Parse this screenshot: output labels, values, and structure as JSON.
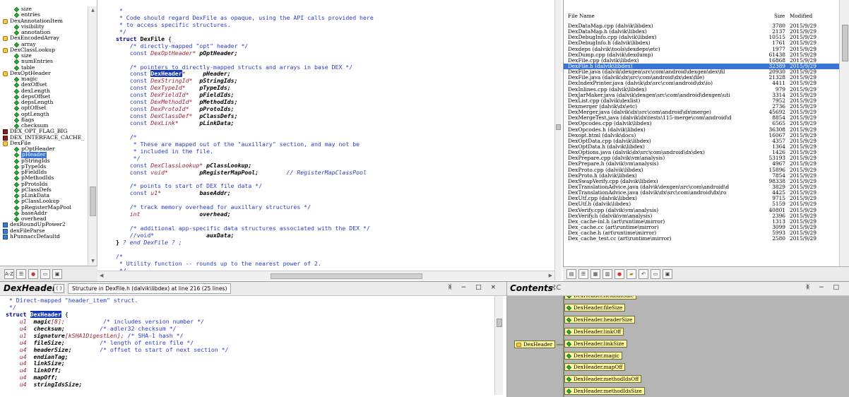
{
  "tree": {
    "items": [
      {
        "label": "size",
        "icon": "field",
        "indent": 2
      },
      {
        "label": "entries",
        "icon": "field",
        "indent": 2
      },
      {
        "label": "DexAnnotationItem",
        "icon": "struct",
        "indent": 1
      },
      {
        "label": "visibility",
        "icon": "field",
        "indent": 2
      },
      {
        "label": "annotation",
        "icon": "field",
        "indent": 2
      },
      {
        "label": "DexEncodedArray",
        "icon": "struct",
        "indent": 1
      },
      {
        "label": "array",
        "icon": "field",
        "indent": 2
      },
      {
        "label": "DexClassLookup",
        "icon": "struct",
        "indent": 1
      },
      {
        "label": "size",
        "icon": "field",
        "indent": 2
      },
      {
        "label": "numEntries",
        "icon": "field",
        "indent": 2
      },
      {
        "label": "table",
        "icon": "field",
        "indent": 2
      },
      {
        "label": "DexOptHeader",
        "icon": "struct",
        "indent": 1
      },
      {
        "label": "magic",
        "icon": "field",
        "indent": 2
      },
      {
        "label": "dexOffset",
        "icon": "field",
        "indent": 2
      },
      {
        "label": "dexLength",
        "icon": "field",
        "indent": 2
      },
      {
        "label": "depsOffset",
        "icon": "field",
        "indent": 2
      },
      {
        "label": "depsLength",
        "icon": "field",
        "indent": 2
      },
      {
        "label": "optOffset",
        "icon": "field",
        "indent": 2
      },
      {
        "label": "optLength",
        "icon": "field",
        "indent": 2
      },
      {
        "label": "flags",
        "icon": "field",
        "indent": 2
      },
      {
        "label": "checksum",
        "icon": "field",
        "indent": 2
      },
      {
        "label": "DEX_OPT_FLAG_BIG",
        "icon": "macro",
        "indent": 1
      },
      {
        "label": "DEX_INTERFACE_CACHE_",
        "icon": "macro",
        "indent": 1
      },
      {
        "label": "DexFile",
        "icon": "struct",
        "indent": 1
      },
      {
        "label": "pOptHeader",
        "icon": "field",
        "indent": 2
      },
      {
        "label": "pHeader",
        "icon": "field",
        "indent": 2,
        "selected": true
      },
      {
        "label": "pStringIds",
        "icon": "field",
        "indent": 2
      },
      {
        "label": "pTypeIds",
        "icon": "field",
        "indent": 2
      },
      {
        "label": "pFieldIds",
        "icon": "field",
        "indent": 2
      },
      {
        "label": "pMethodIds",
        "icon": "field",
        "indent": 2
      },
      {
        "label": "pProtoIds",
        "icon": "field",
        "indent": 2
      },
      {
        "label": "pClassDefs",
        "icon": "field",
        "indent": 2
      },
      {
        "label": "pLinkData",
        "icon": "field",
        "indent": 2
      },
      {
        "label": "pClassLookup",
        "icon": "field",
        "indent": 2
      },
      {
        "label": "pRegisterMapPool",
        "icon": "field",
        "indent": 2
      },
      {
        "label": "baseAddr",
        "icon": "field",
        "indent": 2
      },
      {
        "label": "overhead",
        "icon": "field",
        "indent": 2
      },
      {
        "label": "dexRoundUpPower2",
        "icon": "func",
        "indent": 1
      },
      {
        "label": "dexFileParse",
        "icon": "func",
        "indent": 1
      },
      {
        "label": "hPunnaccDefaultd",
        "icon": "func",
        "indent": 1
      }
    ],
    "toolbar": [
      "A-Z",
      "list",
      "colors",
      "window",
      "save"
    ]
  },
  "editor": {
    "lines": [
      [
        {
          "t": " *",
          "c": "cm"
        }
      ],
      [
        {
          "t": " * Code should regard DexFile as opaque, using the API calls provided here",
          "c": "cm"
        }
      ],
      [
        {
          "t": " * to access specific structures.",
          "c": "cm"
        }
      ],
      [
        {
          "t": " */",
          "c": "cm"
        }
      ],
      [
        {
          "t": "struct ",
          "c": "kw"
        },
        {
          "t": "DexFile",
          "c": "st"
        },
        {
          "t": " {",
          "c": ""
        }
      ],
      [
        {
          "t": "    /* directly-mapped \"opt\" header */",
          "c": "cm"
        }
      ],
      [
        {
          "t": "    const ",
          "c": "cm"
        },
        {
          "t": "DexOptHeader*",
          "c": "tp"
        },
        {
          "t": " pOptHeader;",
          "c": "id"
        }
      ],
      [
        {
          "t": "",
          "c": ""
        }
      ],
      [
        {
          "t": "    /* pointers to directly-mapped structs and arrays in base DEX */",
          "c": "cm"
        }
      ],
      [
        {
          "t": "    const ",
          "c": "cm"
        },
        {
          "t": "DexHeader",
          "c": "hl"
        },
        {
          "t": "*     ",
          "c": "tp"
        },
        {
          "t": "pHeader;",
          "c": "id"
        }
      ],
      [
        {
          "t": "    const ",
          "c": "cm"
        },
        {
          "t": "DexStringId*  ",
          "c": "tp"
        },
        {
          "t": "pStringIds;",
          "c": "id"
        }
      ],
      [
        {
          "t": "    const ",
          "c": "cm"
        },
        {
          "t": "DexTypeId*    ",
          "c": "tp"
        },
        {
          "t": "pTypeIds;",
          "c": "id"
        }
      ],
      [
        {
          "t": "    const ",
          "c": "cm"
        },
        {
          "t": "DexFieldId*   ",
          "c": "tp"
        },
        {
          "t": "pFieldIds;",
          "c": "id"
        }
      ],
      [
        {
          "t": "    const ",
          "c": "cm"
        },
        {
          "t": "DexMethodId*  ",
          "c": "tp"
        },
        {
          "t": "pMethodIds;",
          "c": "id"
        }
      ],
      [
        {
          "t": "    const ",
          "c": "cm"
        },
        {
          "t": "DexProtoId*   ",
          "c": "tp"
        },
        {
          "t": "pProtoIds;",
          "c": "id"
        }
      ],
      [
        {
          "t": "    const ",
          "c": "cm"
        },
        {
          "t": "DexClassDef*  ",
          "c": "tp"
        },
        {
          "t": "pClassDefs;",
          "c": "id"
        }
      ],
      [
        {
          "t": "    const ",
          "c": "cm"
        },
        {
          "t": "DexLink*      ",
          "c": "tp"
        },
        {
          "t": "pLinkData;",
          "c": "id"
        }
      ],
      [
        {
          "t": "",
          "c": ""
        }
      ],
      [
        {
          "t": "    /*",
          "c": "cm"
        }
      ],
      [
        {
          "t": "     * These are mapped out of the \"auxillary\" section, and may not be",
          "c": "cm"
        }
      ],
      [
        {
          "t": "     * included in the file.",
          "c": "cm"
        }
      ],
      [
        {
          "t": "     */",
          "c": "cm"
        }
      ],
      [
        {
          "t": "    const ",
          "c": "cm"
        },
        {
          "t": "DexClassLookup*",
          "c": "tp"
        },
        {
          "t": " pClassLookup;",
          "c": "id"
        }
      ],
      [
        {
          "t": "    const ",
          "c": "cm"
        },
        {
          "t": "void*         ",
          "c": "tp"
        },
        {
          "t": "pRegisterMapPool;",
          "c": "id"
        },
        {
          "t": "        // RegisterMapClassPool",
          "c": "cm2"
        }
      ],
      [
        {
          "t": "",
          "c": ""
        }
      ],
      [
        {
          "t": "    /* points to start of DEX file data */",
          "c": "cm"
        }
      ],
      [
        {
          "t": "    const ",
          "c": "cm"
        },
        {
          "t": "u1*           ",
          "c": "tp"
        },
        {
          "t": "baseAddr;",
          "c": "id"
        }
      ],
      [
        {
          "t": "",
          "c": ""
        }
      ],
      [
        {
          "t": "    /* track memory overhead for auxillary structures */",
          "c": "cm"
        }
      ],
      [
        {
          "t": "    int",
          "c": "tp"
        },
        {
          "t": "                 overhead;",
          "c": "id"
        }
      ],
      [
        {
          "t": "",
          "c": ""
        }
      ],
      [
        {
          "t": "    /* additional app-specific data structures associated with the DEX */",
          "c": "cm"
        }
      ],
      [
        {
          "t": "    //void*",
          "c": "cm"
        },
        {
          "t": "               auxData;",
          "c": "id"
        }
      ],
      [
        {
          "t": "} ",
          "c": "st"
        },
        {
          "t": "? end DexFile ? ;",
          "c": "cm2"
        }
      ],
      [
        {
          "t": "",
          "c": ""
        }
      ],
      [
        {
          "t": "/*",
          "c": "cm"
        }
      ],
      [
        {
          "t": " * Utility function -- rounds up to the nearest power of 2.",
          "c": "cm"
        }
      ],
      [
        {
          "t": " */",
          "c": "cm"
        }
      ]
    ]
  },
  "files": {
    "header": {
      "name": "File Name",
      "size": "Size",
      "modified": "Modified"
    },
    "rows": [
      [
        "DexDataMap.cpp (dalvik\\libdex)",
        "3780",
        "2015/9/29"
      ],
      [
        "DexDataMap.h (dalvik\\libdex)",
        "2137",
        "2015/9/29"
      ],
      [
        "DexDebugInfo.cpp (dalvik\\libdex)",
        "10515",
        "2015/9/29"
      ],
      [
        "DexDebugInfo.h (dalvik\\libdex)",
        "1761",
        "2015/9/29"
      ],
      [
        "Dexdeps (dalvik\\tools\\dexdeps\\etc)",
        "1977",
        "2015/9/29"
      ],
      [
        "DexDump.cpp (dalvik\\dexdump)",
        "61438",
        "2015/9/29"
      ],
      [
        "DexFile.cpp (dalvik\\libdex)",
        "16868",
        "2015/9/29"
      ],
      [
        "DexFile.h (dalvik\\libdex)",
        "32389",
        "2015/9/29"
      ],
      [
        "DexFile.java (dalvik\\dexgen\\src\\com\\android\\dexgen\\dex\\fil",
        "20930",
        "2015/9/29"
      ],
      [
        "DexFile.java (dalvik\\dx\\src\\com\\android\\dx\\dex\\file)",
        "21328",
        "2015/9/29"
      ],
      [
        "DexIndexPrinter.java (dalvik\\dx\\src\\com\\android\\dx\\io)",
        "4411",
        "2015/9/29"
      ],
      [
        "DexInlines.cpp (dalvik\\libdex)",
        "979",
        "2015/9/29"
      ],
      [
        "DexJarMaker.java (dalvik\\dexgen\\src\\com\\android\\dexgen\\uti",
        "3314",
        "2015/9/29"
      ],
      [
        "DexList.cpp (dalvik\\dexlist)",
        "7952",
        "2015/9/29"
      ],
      [
        "Dexmerger (dalvik\\dx\\etc)",
        "2736",
        "2015/9/29"
      ],
      [
        "DexMerger.java (dalvik\\dx\\src\\com\\android\\dx\\merge)",
        "45692",
        "2015/9/29"
      ],
      [
        "DexMergeTest.java (dalvik\\dx\\tests\\115-merge\\com\\android\\d",
        "8854",
        "2015/9/29"
      ],
      [
        "DexOpcodes.cpp (dalvik\\libdex)",
        "6565",
        "2015/9/29"
      ],
      [
        "DexOpcodes.h (dalvik\\libdex)",
        "36308",
        "2015/9/29"
      ],
      [
        "Dexopt.html (dalvik\\docs)",
        "16067",
        "2015/9/29"
      ],
      [
        "DexOptData.cpp (dalvik\\libdex)",
        "4357",
        "2015/9/29"
      ],
      [
        "DexOptData.h (dalvik\\libdex)",
        "1364",
        "2015/9/29"
      ],
      [
        "DexOptions.java (dalvik\\dx\\src\\com\\android\\dx\\dex)",
        "1426",
        "2015/9/29"
      ],
      [
        "DexPrepare.cpp (dalvik\\vm\\analysis)",
        "53193",
        "2015/9/29"
      ],
      [
        "DexPrepare.h (dalvik\\vm\\analysis)",
        "4967",
        "2015/9/29"
      ],
      [
        "DexProto.cpp (dalvik\\libdex)",
        "15896",
        "2015/9/29"
      ],
      [
        "DexProto.h (dalvik\\libdex)",
        "7854",
        "2015/9/29"
      ],
      [
        "DexSwapVerify.cpp (dalvik\\libdex)",
        "98338",
        "2015/9/29"
      ],
      [
        "DexTranslationAdvice.java (dalvik\\dexgen\\src\\com\\android\\d",
        "3829",
        "2015/9/29"
      ],
      [
        "DexTranslationAdvice.java (dalvik\\dx\\src\\com\\android\\dx\\ro",
        "4425",
        "2015/9/29"
      ],
      [
        "DexUtf.cpp (dalvik\\libdex)",
        "9715",
        "2015/9/29"
      ],
      [
        "DexUtf.h (dalvik\\libdex)",
        "5159",
        "2015/9/29"
      ],
      [
        "DexVerify.cpp (dalvik\\vm\\analysis)",
        "40801",
        "2015/9/29"
      ],
      [
        "DexVerify.h (dalvik\\vm\\analysis)",
        "2396",
        "2015/9/29"
      ],
      [
        "Dex_cache-inl.h (art\\runtime\\mirror)",
        "1313",
        "2015/9/29"
      ],
      [
        "Dex_cache.cc (art\\runtime\\mirror)",
        "3099",
        "2015/9/29"
      ],
      [
        "Dex_cache.h (art\\runtime\\mirror)",
        "5993",
        "2015/9/29"
      ],
      [
        "Dex_cache_test.cc (art\\runtime\\mirror)",
        "2580",
        "2015/9/29"
      ]
    ],
    "selected_index": 7,
    "toolbar": [
      "project-window",
      "list",
      "grid",
      "columns",
      "colors",
      "folder",
      "back",
      "window",
      "save"
    ]
  },
  "definition": {
    "title": "DexHeader",
    "info": "Structure in DexFile.h (dalvik\\libdex) at line 216 (25 lines)",
    "window_buttons": "ᛤ − □ ×",
    "lines": [
      [
        {
          "t": " * Direct-mapped \"header_item\" struct.",
          "c": "cm"
        }
      ],
      [
        {
          "t": " */",
          "c": "cm"
        }
      ],
      [
        {
          "t": "struct ",
          "c": "kw"
        },
        {
          "t": "DexHeader",
          "c": "hl"
        },
        {
          "t": " {",
          "c": ""
        }
      ],
      [
        {
          "t": "    u1  ",
          "c": "tp"
        },
        {
          "t": "magic",
          "c": "id"
        },
        {
          "t": "[8];",
          "c": "tp"
        },
        {
          "t": "           /* includes version number */",
          "c": "cm"
        }
      ],
      [
        {
          "t": "    u4  ",
          "c": "tp"
        },
        {
          "t": "checksum;",
          "c": "id"
        },
        {
          "t": "          /* adler32 checksum */",
          "c": "cm"
        }
      ],
      [
        {
          "t": "    u1  ",
          "c": "tp"
        },
        {
          "t": "signature",
          "c": "id"
        },
        {
          "t": "[kSHA1DigestLen];",
          "c": "tp"
        },
        {
          "t": " /* SHA-1 hash */",
          "c": "cm"
        }
      ],
      [
        {
          "t": "    u4  ",
          "c": "tp"
        },
        {
          "t": "fileSize;",
          "c": "id"
        },
        {
          "t": "          /* length of entire file */",
          "c": "cm"
        }
      ],
      [
        {
          "t": "    u4  ",
          "c": "tp"
        },
        {
          "t": "headerSize;",
          "c": "id"
        },
        {
          "t": "        /* offset to start of next section */",
          "c": "cm"
        }
      ],
      [
        {
          "t": "    u4  ",
          "c": "tp"
        },
        {
          "t": "endianTag;",
          "c": "id"
        }
      ],
      [
        {
          "t": "    u4  ",
          "c": "tp"
        },
        {
          "t": "linkSize;",
          "c": "id"
        }
      ],
      [
        {
          "t": "    u4  ",
          "c": "tp"
        },
        {
          "t": "linkOff;",
          "c": "id"
        }
      ],
      [
        {
          "t": "    u4  ",
          "c": "tp"
        },
        {
          "t": "mapOff;",
          "c": "id"
        }
      ],
      [
        {
          "t": "    u4  ",
          "c": "tp"
        },
        {
          "t": "stringIdsSize;",
          "c": "id"
        }
      ]
    ]
  },
  "contents": {
    "title": "Contents",
    "window_buttons": "ᛤ − □",
    "root": "DexHeader",
    "children": [
      "DexHeader.fieldIdsSize",
      "DexHeader.fileSize",
      "DexHeader.headerSize",
      "DexHeader.linkOff",
      "DexHeader.linkSize",
      "DexHeader.magic",
      "DexHeader.mapOff",
      "DexHeader.methodIdsOff",
      "DexHeader.methodIdsSize"
    ]
  },
  "colors": {
    "selection": "#3875d7",
    "highlight": "#1437b8",
    "graph_bg": "#b5b5b5",
    "node_fill": "#fff89e",
    "comment": "#2a3ec2",
    "type": "#9b2335"
  }
}
